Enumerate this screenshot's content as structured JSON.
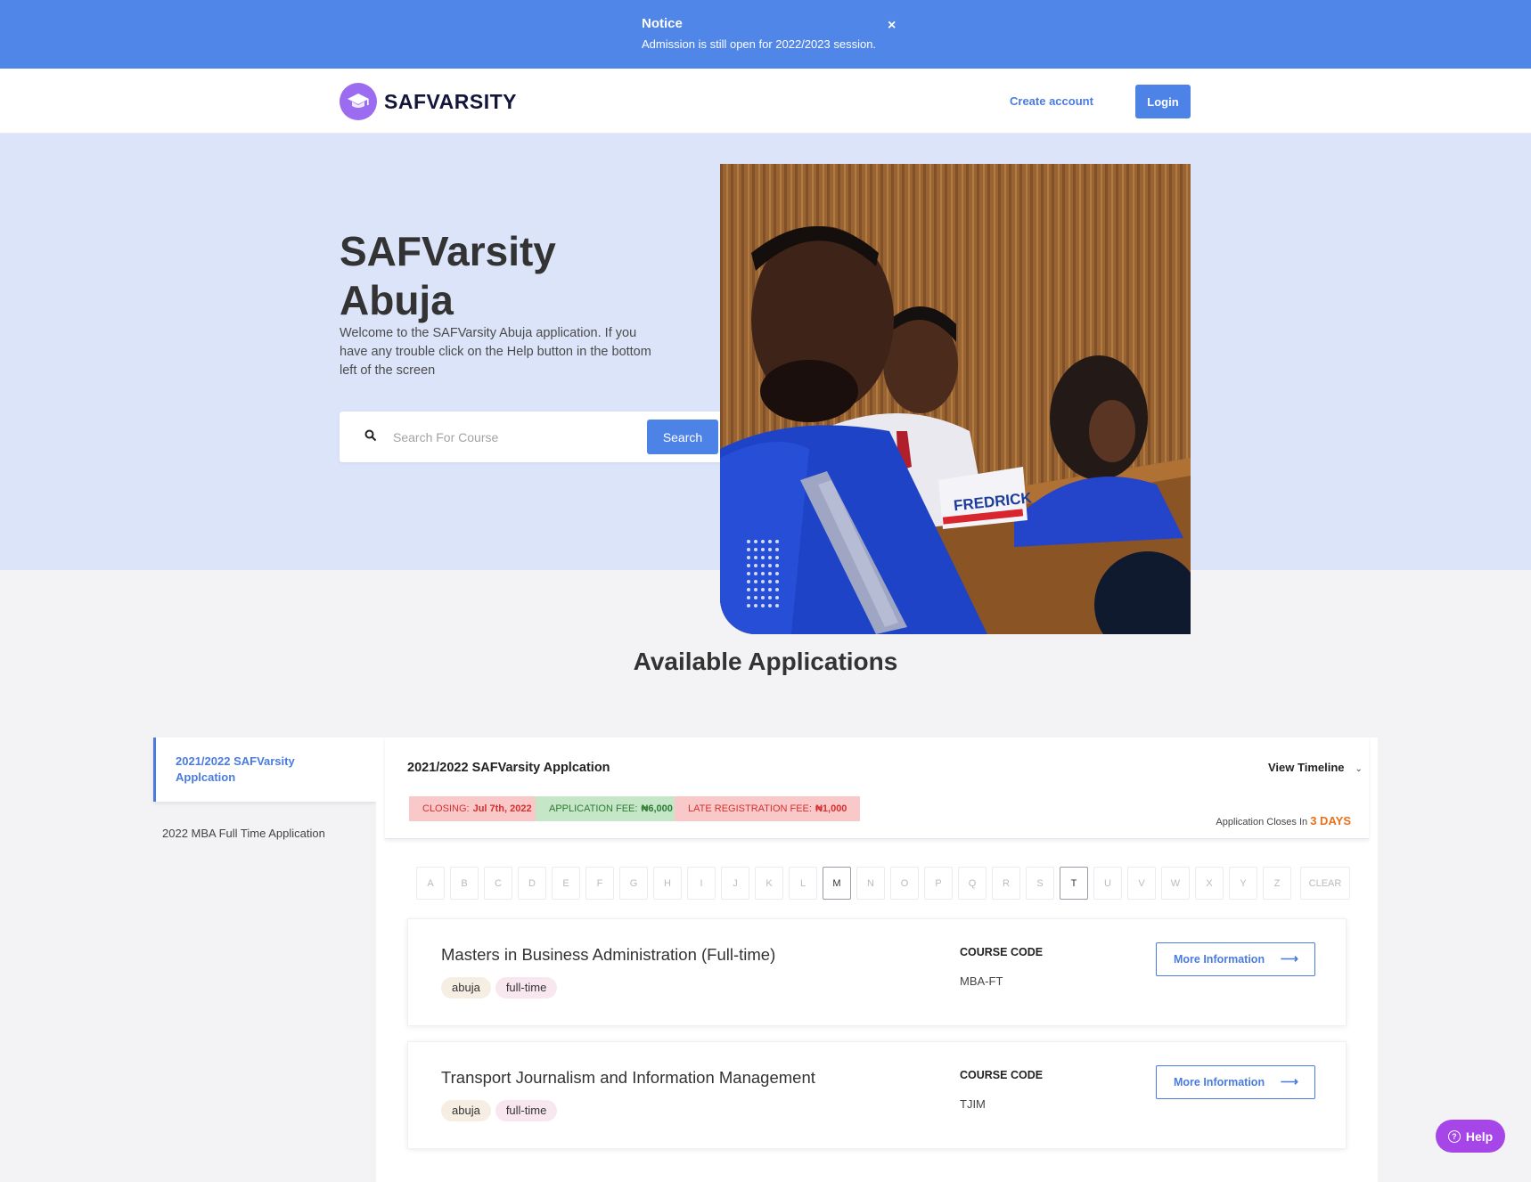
{
  "notice": {
    "title": "Notice",
    "text": "Admission is still open for 2022/2023 session.",
    "close_icon": "×"
  },
  "header": {
    "logo_text": "SAFVARSITY",
    "create_account": "Create account",
    "login": "Login"
  },
  "hero": {
    "title": "SAFVarsity Abuja",
    "description": "Welcome to the SAFVarsity Abuja application. If you have any trouble click on the Help button in the bottom left of the screen",
    "search_placeholder": "Search For Course",
    "search_button": "Search",
    "photo_nameplate": "FREDRICK"
  },
  "available_applications": {
    "title": "Available Applications"
  },
  "sidebar": {
    "items": [
      {
        "label": "2021/2022 SAFVarsity Applcation",
        "active": true
      },
      {
        "label": "2022 MBA Full Time Application",
        "active": false
      }
    ]
  },
  "application": {
    "title": "2021/2022 SAFVarsity Applcation",
    "view_timeline": "View Timeline",
    "closing_label": "CLOSING:",
    "closing_value": "Jul 7th, 2022",
    "fee_label": "APPLICATION FEE:",
    "fee_value": "₦6,000",
    "late_fee_label": "LATE REGISTRATION FEE:",
    "late_fee_value": "₦1,000",
    "closes_in_label": "Application Closes In",
    "closes_in_value": "3 DAYS"
  },
  "alphabet": {
    "letters": [
      "A",
      "B",
      "C",
      "D",
      "E",
      "F",
      "G",
      "H",
      "I",
      "J",
      "K",
      "L",
      "M",
      "N",
      "O",
      "P",
      "Q",
      "R",
      "S",
      "T",
      "U",
      "V",
      "W",
      "X",
      "Y",
      "Z"
    ],
    "active": [
      "M",
      "T"
    ],
    "clear": "CLEAR"
  },
  "courses": [
    {
      "title": "Masters in Business Administration (Full-time)",
      "tags": [
        "abuja",
        "full-time"
      ],
      "code_label": "COURSE CODE",
      "code": "MBA-FT",
      "button": "More Information"
    },
    {
      "title": "Transport Journalism and Information Management",
      "tags": [
        "abuja",
        "full-time"
      ],
      "code_label": "COURSE CODE",
      "code": "TJIM",
      "button": "More Information"
    }
  ],
  "help": {
    "label": "Help"
  },
  "colors": {
    "primary": "#4d82e6",
    "notice_bg": "#5086e8",
    "hero_bg": "#dbe4f8",
    "help_bg": "#a646e8",
    "closing_red": "#d62f2f",
    "fee_green": "#2d7a34",
    "days_orange": "#e8701a"
  }
}
